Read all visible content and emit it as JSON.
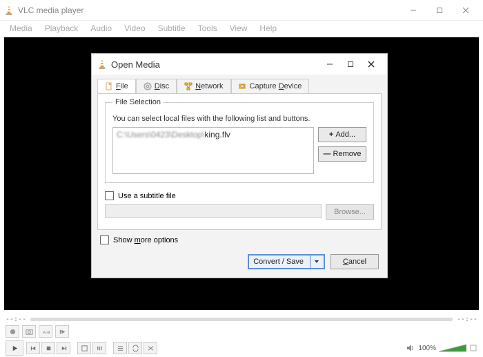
{
  "window": {
    "title": "VLC media player",
    "menus": [
      "Media",
      "Playback",
      "Audio",
      "Video",
      "Subtitle",
      "Tools",
      "View",
      "Help"
    ]
  },
  "dialog": {
    "title": "Open Media",
    "tabs": {
      "file": "File",
      "disc": "Disc",
      "network": "Network",
      "capture": "Capture Device"
    },
    "fileselection": {
      "legend": "File Selection",
      "hint": "You can select local files with the following list and buttons.",
      "file_blur": "C:\\Users\\0423\\Desktop\\",
      "file_clear": "king.flv"
    },
    "buttons": {
      "add": "Add...",
      "remove": "Remove",
      "browse": "Browse...",
      "convert": "Convert / Save",
      "cancel": "Cancel"
    },
    "subs_label": "Use a subtitle file",
    "more_opts": "Show more options"
  },
  "player": {
    "time_left": "--:--",
    "time_right": "--:--",
    "volume_label": "100%"
  }
}
